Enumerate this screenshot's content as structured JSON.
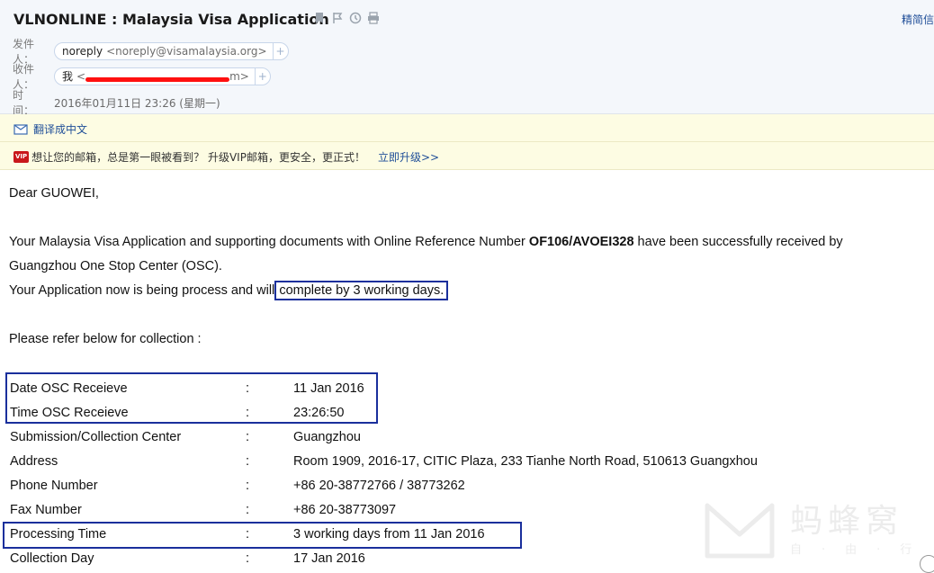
{
  "header": {
    "subject": "VLNONLINE : Malaysia Visa Application",
    "right_link": "精简信",
    "from_label": "发件人：",
    "from_name": "noreply",
    "from_email": "<noreply@visamalaysia.org>",
    "to_label": "收件人：",
    "to_name": "我",
    "to_email_prefix": "<",
    "to_email_suffix": "m>",
    "time_label": "时　间：",
    "time_value": "2016年01月11日 23:26 (星期一)",
    "plus": "+"
  },
  "translate_bar": {
    "label": "翻译成中文"
  },
  "vip_bar": {
    "badge": "VIP",
    "text": "想让您的邮箱，总是第一眼被看到？ 升级VIP邮箱，更安全，更正式！",
    "link": "立即升级>>"
  },
  "email": {
    "greeting": "Dear GUOWEI,",
    "p1_a": "Your Malaysia Visa Application and supporting documents with Online Reference Number ",
    "p1_ref": "OF106/AVOEI328",
    "p1_b": " have been successfully received by",
    "p1_c": "Guangzhou One Stop Center (OSC).",
    "p2_a": "Your Application now is being process and will ",
    "p2_hl": "complete by 3 working days.",
    "p3": "Please refer below for collection :",
    "rows": [
      {
        "label": "Date OSC Receieve",
        "sep": ":",
        "value": "11 Jan 2016"
      },
      {
        "label": "Time OSC Receieve",
        "sep": ":",
        "value": "23:26:50"
      },
      {
        "label": "Submission/Collection Center",
        "sep": ":",
        "value": "Guangzhou"
      },
      {
        "label": "Address",
        "sep": ":",
        "value": "Room 1909, 2016-17, CITIC Plaza, 233 Tianhe North Road, 510613 Guangxhou"
      },
      {
        "label": "Phone Number",
        "sep": ":",
        "value": "+86 20-38772766 / 38773262"
      },
      {
        "label": "Fax Number",
        "sep": ":",
        "value": "+86 20-38773097"
      },
      {
        "label": "Processing Time",
        "sep": ":",
        "value": "3 working days from 11 Jan 2016"
      },
      {
        "label": "Collection Day",
        "sep": ":",
        "value": "17 Jan 2016"
      }
    ]
  },
  "watermark": {
    "text": "蚂蜂窝",
    "sub": "自·由·行"
  },
  "colors": {
    "highlight_box": "#1a2f9c",
    "link": "#1f4e98",
    "vip_red": "#c9181b",
    "redaction": "#ff1010"
  }
}
